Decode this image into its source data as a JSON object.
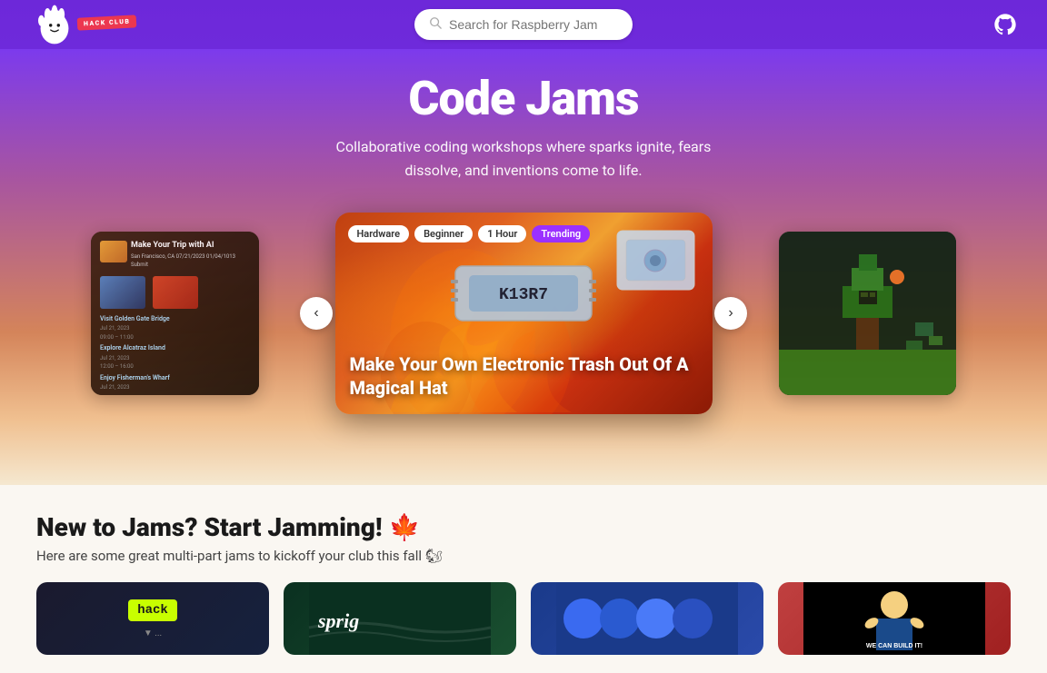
{
  "navbar": {
    "logo_alt": "Hack Club",
    "search_placeholder": "Search for Raspberry Jam",
    "github_label": "GitHub"
  },
  "hero": {
    "title": "Code Jams",
    "subtitle": "Collaborative coding workshops where sparks ignite, fears dissolve, and inventions come to life."
  },
  "featured_card": {
    "tags": [
      "Hardware",
      "Beginner",
      "1 Hour",
      "Trending"
    ],
    "title": "Make Your Own Electronic Trash Out Of A Magical Hat"
  },
  "side_card_left": {
    "title": "Make Your Trip with AI",
    "meta": "San Francisco, CA  07/21/2023  01/04/1013  Submit",
    "items": [
      "Visit Golden Gate Bridge",
      "Jul 21, 2023",
      "09:00 – 11:00",
      "Explore Alcatraz Island",
      "Jul 21, 2023",
      "12:00 – 16:00",
      "Enjoy Fisherman's Wharf",
      "Jul 21, 2023"
    ]
  },
  "bottom": {
    "title": "New to Jams? Start Jamming! 🍁",
    "subtitle": "Here are some great multi-part jams to kickoff your club this fall 🐿"
  },
  "carousel": {
    "prev_label": "‹",
    "next_label": "›"
  }
}
